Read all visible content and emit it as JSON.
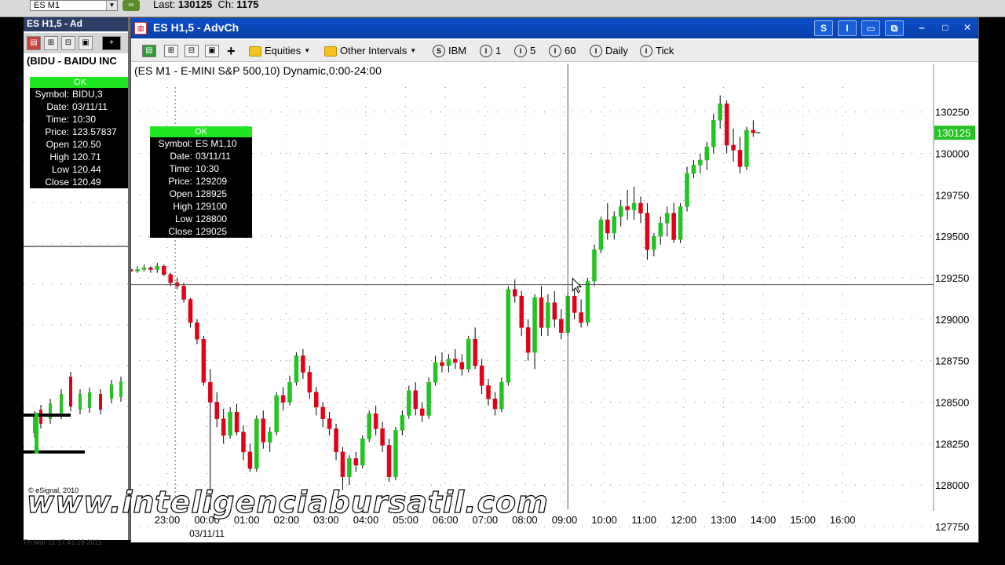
{
  "topbar": {
    "symbol": "ES M1",
    "last_label": "Last:",
    "last_value": "130125",
    "ch_label": "Ch:",
    "ch_value": "1175"
  },
  "left_panel": {
    "title_strip": "ES H1,5 - Ad",
    "chart_title": "(BIDU - BAIDU INC",
    "ok": "OK",
    "fields": [
      {
        "k": "Symbol:",
        "v": "BIDU,3"
      },
      {
        "k": "Date:",
        "v": "03/11/11"
      },
      {
        "k": "Time:",
        "v": "10:30"
      },
      {
        "k": "Price:",
        "v": "123.57837"
      },
      {
        "k": "Open",
        "v": "120.50"
      },
      {
        "k": "High",
        "v": "120.71"
      },
      {
        "k": "Low",
        "v": "120.44"
      },
      {
        "k": "Close",
        "v": "120.49"
      }
    ],
    "footer": "© eSignal, 2010"
  },
  "window": {
    "title": "ES H1,5 - AdvCh",
    "icons": {
      "window": "chart-window-icon"
    }
  },
  "toolbar": {
    "equities": "Equities",
    "other_intervals": "Other Intervals",
    "ibm": "IBM",
    "i1": "1",
    "i5": "5",
    "i60": "60",
    "daily": "Daily",
    "tick": "Tick"
  },
  "chart_title": "(ES M1 - E-MINI S&P 500,10) Dynamic,0:00-24:00",
  "main_box": {
    "ok": "OK",
    "fields": [
      {
        "k": "Symbol:",
        "v": "ES M1,10"
      },
      {
        "k": "Date:",
        "v": "03/11/11"
      },
      {
        "k": "Time:",
        "v": "10:30"
      },
      {
        "k": "Price:",
        "v": "129209"
      },
      {
        "k": "Open",
        "v": "128925"
      },
      {
        "k": "High",
        "v": "129100"
      },
      {
        "k": "Low",
        "v": "128800"
      },
      {
        "k": "Close",
        "v": "129025"
      }
    ]
  },
  "colors": {
    "up": "#22c322",
    "down": "#e0001a",
    "price_tag": "#22c322"
  },
  "watermark": "www.inteligenciabursatil.com",
  "status": "Fri Mar 11 17:41:28 2011",
  "chart_data": {
    "type": "candlestick",
    "title": "(ES M1 - E-MINI S&P 500,10) Dynamic,0:00-24:00",
    "ylim": [
      127750,
      130400
    ],
    "y_ticks": [
      127750,
      128000,
      128250,
      128500,
      128750,
      129000,
      129250,
      129500,
      129750,
      130000,
      130250
    ],
    "last_price": 130125,
    "x_tick_labels": [
      "23:00",
      "00:00",
      "01:00",
      "02:00",
      "03:00",
      "04:00",
      "05:00",
      "06:00",
      "07:00",
      "08:00",
      "09:00",
      "10:00",
      "11:00",
      "12:00",
      "13:00",
      "14:00",
      "15:00",
      "16:00"
    ],
    "date_label": "03/11/11",
    "crosshair_price": 129209,
    "crosshair_x_index": 66,
    "bars_per_hour": 6,
    "candles": [
      [
        129300,
        129310,
        129280,
        129290
      ],
      [
        129290,
        129320,
        129280,
        129300
      ],
      [
        129300,
        129330,
        129290,
        129310
      ],
      [
        129310,
        129320,
        129280,
        129300
      ],
      [
        129300,
        129340,
        129280,
        129320
      ],
      [
        129320,
        129330,
        129260,
        129270
      ],
      [
        129270,
        129280,
        129200,
        129220
      ],
      [
        129220,
        129250,
        129180,
        129200
      ],
      [
        129200,
        129220,
        129100,
        129120
      ],
      [
        129120,
        129130,
        128950,
        128980
      ],
      [
        128980,
        129000,
        128850,
        128880
      ],
      [
        128880,
        128900,
        128600,
        128620
      ],
      [
        128620,
        128700,
        127850,
        128500
      ],
      [
        128500,
        128560,
        128350,
        128400
      ],
      [
        128400,
        128460,
        128250,
        128300
      ],
      [
        128300,
        128470,
        128280,
        128440
      ],
      [
        128440,
        128490,
        128300,
        128320
      ],
      [
        128320,
        128360,
        128150,
        128200
      ],
      [
        128200,
        128250,
        128080,
        128100
      ],
      [
        128100,
        128420,
        128080,
        128400
      ],
      [
        128400,
        128450,
        128220,
        128260
      ],
      [
        128260,
        128350,
        128200,
        128320
      ],
      [
        128320,
        128560,
        128300,
        128540
      ],
      [
        128540,
        128590,
        128450,
        128500
      ],
      [
        128500,
        128660,
        128480,
        128620
      ],
      [
        128620,
        128800,
        128600,
        128780
      ],
      [
        128780,
        128820,
        128640,
        128680
      ],
      [
        128680,
        128720,
        128520,
        128560
      ],
      [
        128560,
        128590,
        128420,
        128470
      ],
      [
        128470,
        128500,
        128350,
        128400
      ],
      [
        128400,
        128440,
        128300,
        128340
      ],
      [
        128340,
        128370,
        128150,
        128200
      ],
      [
        128200,
        128230,
        127970,
        128050
      ],
      [
        128050,
        128180,
        128000,
        128160
      ],
      [
        128160,
        128200,
        128080,
        128120
      ],
      [
        128120,
        128300,
        128100,
        128280
      ],
      [
        128280,
        128450,
        128260,
        128430
      ],
      [
        128430,
        128480,
        128300,
        128340
      ],
      [
        128340,
        128380,
        128200,
        128240
      ],
      [
        128240,
        128280,
        128020,
        128050
      ],
      [
        128050,
        128350,
        128030,
        128330
      ],
      [
        128330,
        128450,
        128300,
        128420
      ],
      [
        128420,
        128600,
        128400,
        128570
      ],
      [
        128570,
        128620,
        128420,
        128460
      ],
      [
        128460,
        128500,
        128380,
        128420
      ],
      [
        128420,
        128650,
        128400,
        128620
      ],
      [
        128620,
        128780,
        128600,
        128740
      ],
      [
        128740,
        128800,
        128680,
        128720
      ],
      [
        128720,
        128790,
        128680,
        128760
      ],
      [
        128760,
        128820,
        128700,
        128740
      ],
      [
        128740,
        128790,
        128660,
        128700
      ],
      [
        128700,
        128900,
        128680,
        128880
      ],
      [
        128880,
        128950,
        128700,
        128720
      ],
      [
        128720,
        128760,
        128550,
        128600
      ],
      [
        128600,
        128640,
        128480,
        128520
      ],
      [
        128520,
        128560,
        128420,
        128460
      ],
      [
        128460,
        128650,
        128440,
        128620
      ],
      [
        128620,
        129200,
        128600,
        129180
      ],
      [
        129180,
        129240,
        129100,
        129140
      ],
      [
        129140,
        129170,
        128900,
        128950
      ],
      [
        128950,
        129000,
        128750,
        128800
      ],
      [
        128800,
        129150,
        128700,
        129130
      ],
      [
        129130,
        129200,
        128900,
        128950
      ],
      [
        128950,
        129150,
        128900,
        129100
      ],
      [
        129100,
        129170,
        128950,
        129000
      ],
      [
        129000,
        129060,
        128880,
        128920
      ],
      [
        128920,
        129160,
        128900,
        129140
      ],
      [
        129140,
        129200,
        129000,
        129040
      ],
      [
        129040,
        129120,
        128950,
        128980
      ],
      [
        128980,
        129250,
        128960,
        129230
      ],
      [
        129230,
        129450,
        129200,
        129420
      ],
      [
        129420,
        129620,
        129400,
        129600
      ],
      [
        129600,
        129700,
        129480,
        129520
      ],
      [
        129520,
        129650,
        129480,
        129620
      ],
      [
        129620,
        129720,
        129560,
        129680
      ],
      [
        129680,
        129780,
        129600,
        129660
      ],
      [
        129660,
        129800,
        129600,
        129700
      ],
      [
        129700,
        129740,
        129580,
        129640
      ],
      [
        129640,
        129700,
        129360,
        129420
      ],
      [
        129420,
        129520,
        129380,
        129500
      ],
      [
        129500,
        129620,
        129450,
        129580
      ],
      [
        129580,
        129680,
        129500,
        129640
      ],
      [
        129640,
        129700,
        129460,
        129480
      ],
      [
        129480,
        129700,
        129460,
        129680
      ],
      [
        129680,
        129920,
        129650,
        129880
      ],
      [
        129880,
        129960,
        129850,
        129930
      ],
      [
        129930,
        130000,
        129880,
        129960
      ],
      [
        129960,
        130070,
        129900,
        130040
      ],
      [
        130040,
        130240,
        130000,
        130200
      ],
      [
        130200,
        130350,
        130150,
        130300
      ],
      [
        130300,
        130320,
        130000,
        130050
      ],
      [
        130050,
        130150,
        129950,
        130020
      ],
      [
        130020,
        130100,
        129880,
        129920
      ],
      [
        129920,
        130160,
        129900,
        130140
      ],
      [
        130140,
        130200,
        130100,
        130125
      ]
    ]
  }
}
